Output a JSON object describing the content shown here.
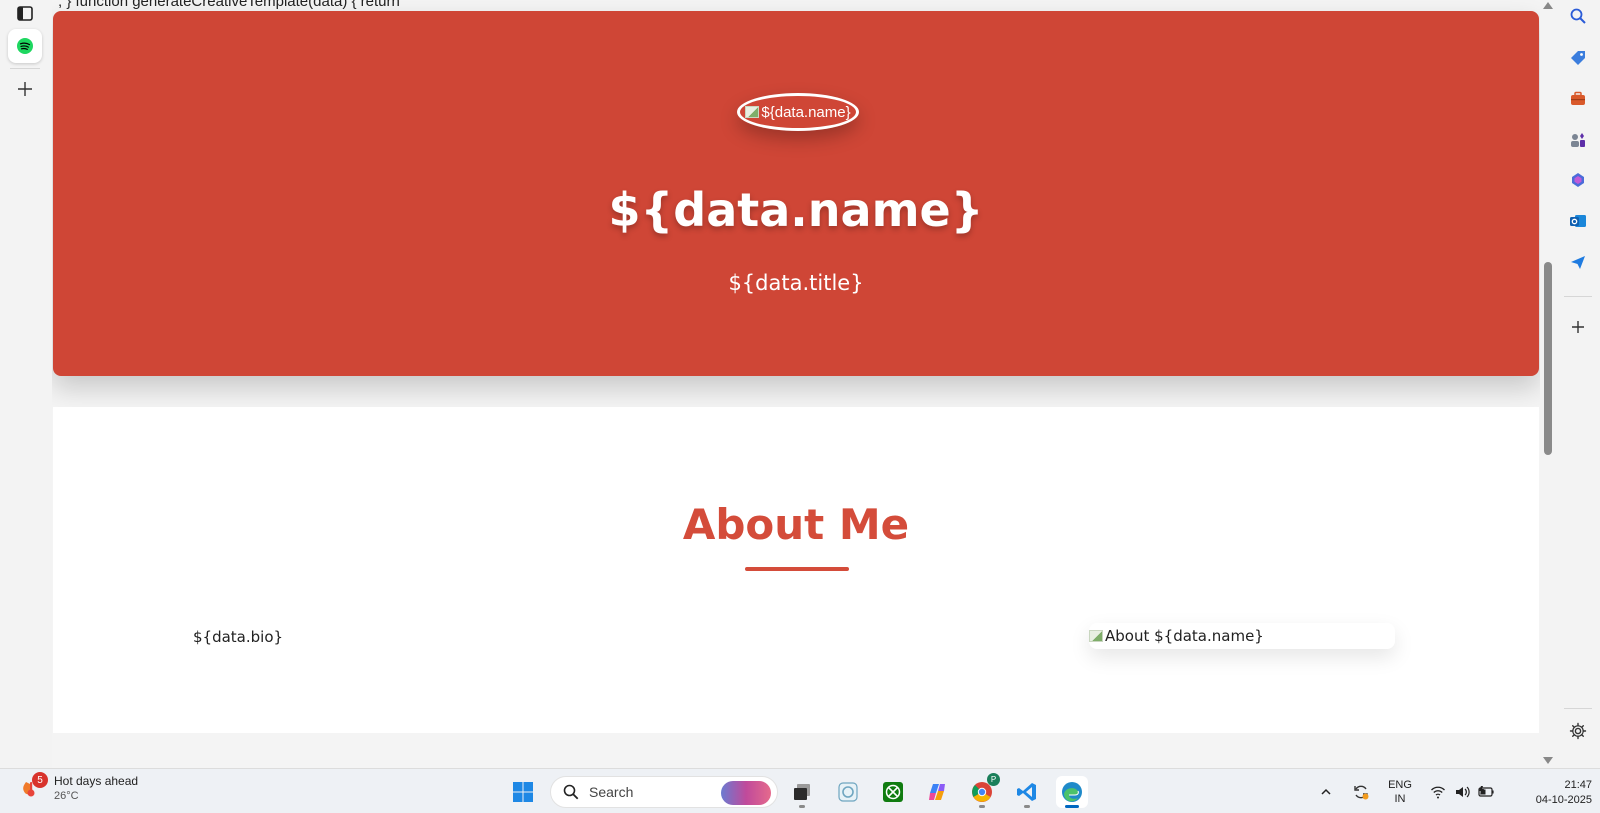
{
  "page": {
    "code_line": "; } function generateCreativeTemplate(data) { return",
    "hero": {
      "avatar_alt": "${data.name}",
      "name": "${data.name}",
      "title": "${data.title}"
    },
    "about": {
      "heading": "About Me",
      "bio": "${data.bio}",
      "image_alt": "About ${data.name}"
    }
  },
  "left_strip": {
    "items": [
      {
        "icon": "tab-actions-icon"
      },
      {
        "icon": "spotify-icon",
        "active": true
      },
      {
        "icon": "add-tab-icon"
      }
    ]
  },
  "right_sidebar": {
    "items": [
      "search-icon",
      "tag-icon",
      "briefcase-icon",
      "games-icon",
      "copilot-icon",
      "outlook-icon",
      "send-icon",
      "add-icon",
      "settings-icon"
    ]
  },
  "taskbar": {
    "weather": {
      "badge": "5",
      "title": "Hot days ahead",
      "temp": "26°C"
    },
    "search_placeholder": "Search",
    "apps": [
      "windows-start-icon",
      "file-manager-icon",
      "app-icon",
      "xbox-icon",
      "copilot-icon",
      "chrome-icon",
      "vscode-icon",
      "edge-icon"
    ],
    "chrome_badge": "P",
    "tray": {
      "lang_line1": "ENG",
      "lang_line2": "IN"
    },
    "clock": {
      "time": "21:47",
      "date": "04-10-2025"
    }
  },
  "colors": {
    "hero_bg": "#cf4636",
    "accent": "#d44c3a"
  }
}
